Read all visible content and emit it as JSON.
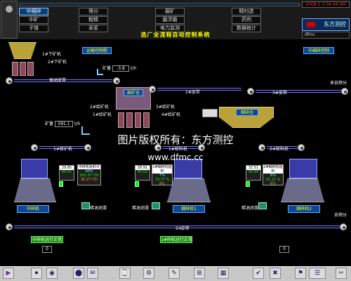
{
  "menu": {
    "row1": [
      "中细碎",
      "筛分",
      "磨矿",
      "精扫选"
    ],
    "row2": [
      "中矿",
      "粗精",
      "磨浮磨",
      "药剂"
    ],
    "row3": [
      "子煤",
      "采浆",
      "电力监测",
      "数据统计"
    ]
  },
  "header": {
    "datetime": "2008-2-3 04:44 AM",
    "brand": "东方测控",
    "user": "dfmc",
    "title": "选厂全流程自动控制系统"
  },
  "controls": {
    "mode_btn": "运输控制程",
    "mid_control_btn": "中细碎控制",
    "left_run_btn": "中碎机运行正常",
    "mid_run_btn": "1#碎机运行正常"
  },
  "labels": {
    "ore1": "1#下矿机",
    "ore2": "2#下矿机",
    "feed_belt": "振动皮带",
    "ore_weight_label": "矿量",
    "ore_weight": "-3.8",
    "ore_unit": "t/h",
    "raw_bin": "原矿仓",
    "belt3": "3#皮带",
    "belt2": "2#皮带",
    "from_screen": "来自筛分",
    "feeder2": "2#给矿机",
    "feeder3": "3#给矿机",
    "feeder1": "1#给矿机",
    "feeder4": "4#给矿机",
    "fine_bin": "细碎仓",
    "ore_weight2_label": "矿量",
    "ore_weight2": "591.1",
    "ore_unit2": "t/h",
    "feeder_right1": "1#给料机",
    "feeder_right2": "2#给料机",
    "mill_left": "中碎机",
    "mill_mid": "细碎机1",
    "mill_right": "细碎机2",
    "lube1": "稀油润滑",
    "lube2": "稀油润滑",
    "lube3": "稀油润滑",
    "belt24": "24皮带",
    "to_screen": "去筛分",
    "belt_bottom": "24皮带",
    "bottom_val1": "0",
    "bottom_val2": "0"
  },
  "panels": {
    "left_small": {
      "top": "29.85",
      "mid": "44.01"
    },
    "left": {
      "title": "中碎机给料计",
      "l1": "60%",
      "l2": "591.07 T/h",
      "l3": "35.27 T/h"
    },
    "mid_small": {
      "top": "28.91",
      "mid": "43.02"
    },
    "mid": {
      "title": "1#细碎机给料",
      "l1": "7%",
      "l2": "74.77 %",
      "l3": "8%"
    },
    "right_small": {
      "top": "32.51",
      "mid": "50.64"
    },
    "right": {
      "title": "2#细碎机给料",
      "l1": "6%",
      "l2": "15.11 %",
      "l3": "6%"
    }
  },
  "toolbar": [
    "▶",
    "⏺",
    "◉",
    "⬤",
    "✉",
    "⌚",
    "⚙",
    "✎",
    "⊞",
    "▦",
    "✔",
    "✖",
    "⚑",
    "☰",
    "✂"
  ],
  "watermark": {
    "line1": "图片版权所有：东方测控",
    "line2": "www.dfmc.cc"
  }
}
